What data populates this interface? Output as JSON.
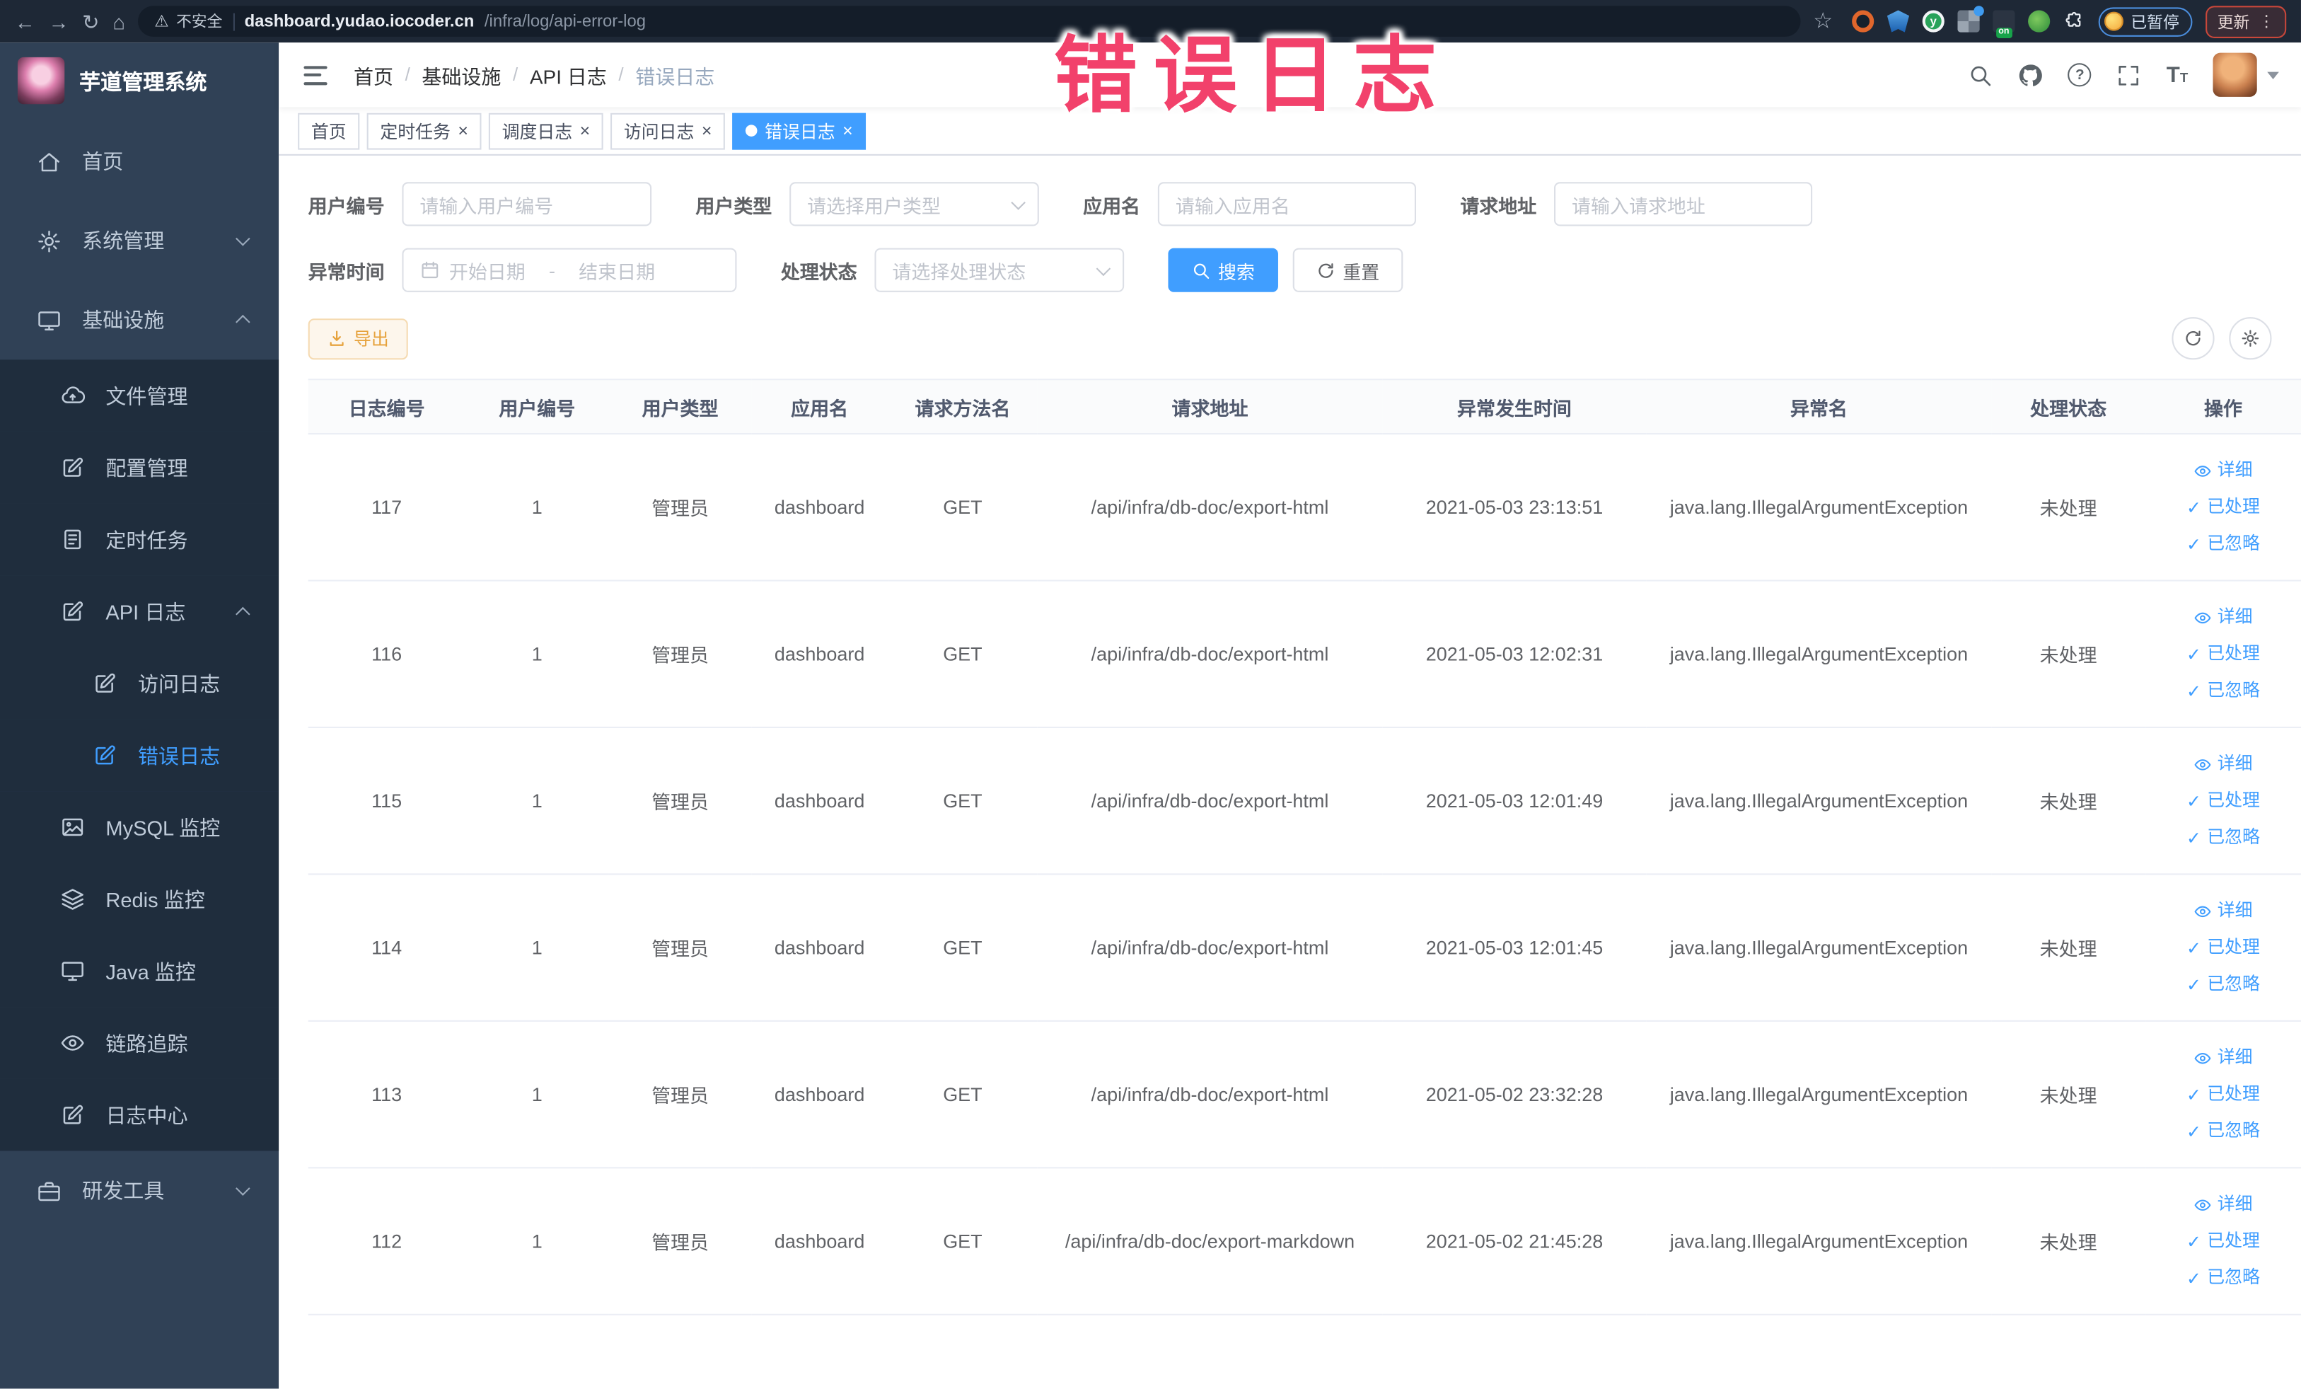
{
  "browser": {
    "security_label": "不安全",
    "url_host": "dashboard.yudao.iocoder.cn",
    "url_path": "/infra/log/api-error-log",
    "on_badge": "on",
    "paused_label": "已暂停",
    "update_label": "更新"
  },
  "overlay": {
    "text": "错误日志"
  },
  "sidebar": {
    "title": "芋道管理系统",
    "items": [
      {
        "label": "首页",
        "icon": "home-icon",
        "level": 0
      },
      {
        "label": "系统管理",
        "icon": "gear-icon",
        "level": 0,
        "chevron": "down"
      },
      {
        "label": "基础设施",
        "icon": "monitor-icon",
        "level": 0,
        "chevron": "up"
      },
      {
        "label": "文件管理",
        "icon": "upload-cloud-icon",
        "level": 1
      },
      {
        "label": "配置管理",
        "icon": "edit-icon",
        "level": 1
      },
      {
        "label": "定时任务",
        "icon": "document-icon",
        "level": 1
      },
      {
        "label": "API 日志",
        "icon": "edit-icon",
        "level": 1,
        "chevron": "up"
      },
      {
        "label": "访问日志",
        "icon": "edit-icon",
        "level": 2
      },
      {
        "label": "错误日志",
        "icon": "edit-icon",
        "level": 2,
        "active": true
      },
      {
        "label": "MySQL 监控",
        "icon": "image-icon",
        "level": 1
      },
      {
        "label": "Redis 监控",
        "icon": "layers-icon",
        "level": 1
      },
      {
        "label": "Java 监控",
        "icon": "monitor-icon",
        "level": 1
      },
      {
        "label": "链路追踪",
        "icon": "eye-icon",
        "level": 1
      },
      {
        "label": "日志中心",
        "icon": "edit-icon",
        "level": 1
      },
      {
        "label": "研发工具",
        "icon": "briefcase-icon",
        "level": 0,
        "chevron": "down"
      }
    ]
  },
  "navbar": {
    "breadcrumb": [
      "首页",
      "基础设施",
      "API 日志",
      "错误日志"
    ]
  },
  "tabs": [
    {
      "label": "首页",
      "closable": false,
      "active": false
    },
    {
      "label": "定时任务",
      "closable": true,
      "active": false
    },
    {
      "label": "调度日志",
      "closable": true,
      "active": false
    },
    {
      "label": "访问日志",
      "closable": true,
      "active": false
    },
    {
      "label": "错误日志",
      "closable": true,
      "active": true
    }
  ],
  "filters": {
    "user_id": {
      "label": "用户编号",
      "placeholder": "请输入用户编号"
    },
    "user_type": {
      "label": "用户类型",
      "placeholder": "请选择用户类型"
    },
    "app_name": {
      "label": "应用名",
      "placeholder": "请输入应用名"
    },
    "request_url": {
      "label": "请求地址",
      "placeholder": "请输入请求地址"
    },
    "exception_time": {
      "label": "异常时间",
      "start_placeholder": "开始日期",
      "separator": "-",
      "end_placeholder": "结束日期"
    },
    "process_status": {
      "label": "处理状态",
      "placeholder": "请选择处理状态"
    },
    "search_label": "搜索",
    "reset_label": "重置"
  },
  "toolbar": {
    "export_label": "导出"
  },
  "table": {
    "columns": [
      "日志编号",
      "用户编号",
      "用户类型",
      "应用名",
      "请求方法名",
      "请求地址",
      "异常发生时间",
      "异常名",
      "处理状态",
      "操作"
    ],
    "row_actions": [
      "详细",
      "已处理",
      "已忽略"
    ],
    "rows": [
      [
        "117",
        "1",
        "管理员",
        "dashboard",
        "GET",
        "/api/infra/db-doc/export-html",
        "2021-05-03 23:13:51",
        "java.lang.IllegalArgumentException",
        "未处理"
      ],
      [
        "116",
        "1",
        "管理员",
        "dashboard",
        "GET",
        "/api/infra/db-doc/export-html",
        "2021-05-03 12:02:31",
        "java.lang.IllegalArgumentException",
        "未处理"
      ],
      [
        "115",
        "1",
        "管理员",
        "dashboard",
        "GET",
        "/api/infra/db-doc/export-html",
        "2021-05-03 12:01:49",
        "java.lang.IllegalArgumentException",
        "未处理"
      ],
      [
        "114",
        "1",
        "管理员",
        "dashboard",
        "GET",
        "/api/infra/db-doc/export-html",
        "2021-05-03 12:01:45",
        "java.lang.IllegalArgumentException",
        "未处理"
      ],
      [
        "113",
        "1",
        "管理员",
        "dashboard",
        "GET",
        "/api/infra/db-doc/export-html",
        "2021-05-02 23:32:28",
        "java.lang.IllegalArgumentException",
        "未处理"
      ],
      [
        "112",
        "1",
        "管理员",
        "dashboard",
        "GET",
        "/api/infra/db-doc/export-markdown",
        "2021-05-02 21:45:28",
        "java.lang.IllegalArgumentException",
        "未处理"
      ]
    ]
  },
  "colors": {
    "accent": "#409eff",
    "sidebar_bg": "#304156",
    "submenu_bg": "#1f2d3d",
    "warning_text": "#e6a23c",
    "overlay_pink": "#f2416b"
  }
}
